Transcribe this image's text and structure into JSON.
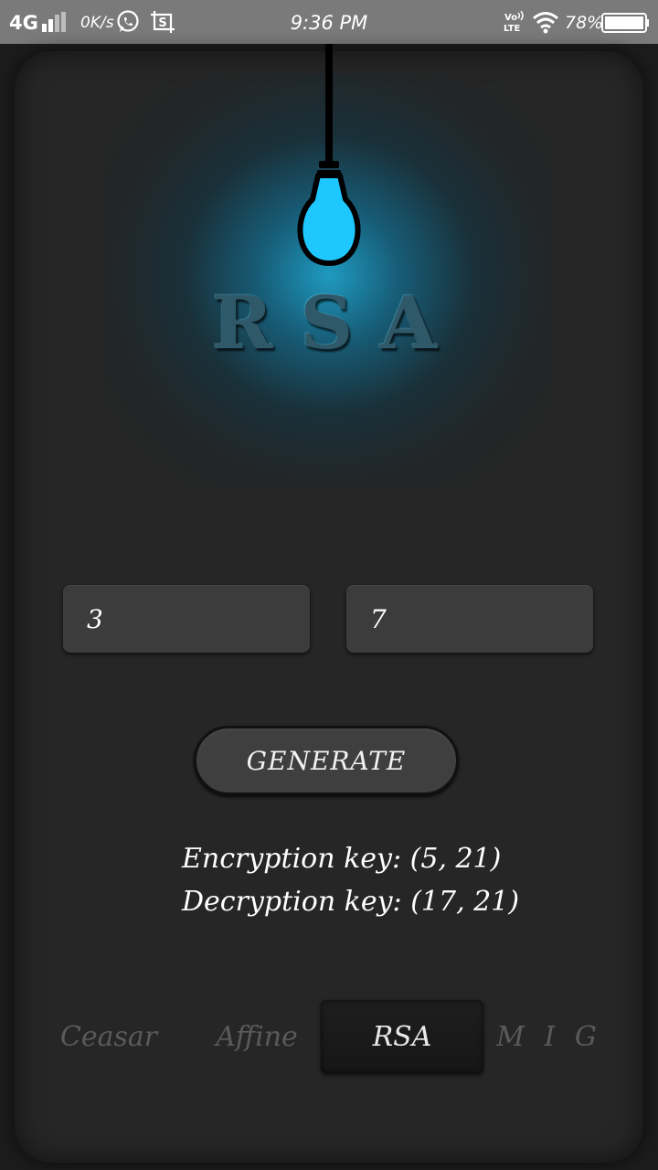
{
  "status_bar": {
    "network": "4G",
    "speed": "0K/s",
    "time": "9:36 PM",
    "volte": "VoLTE",
    "battery_pct": "78%",
    "icons": [
      "signal-icon",
      "whatsapp-icon",
      "screenshot-icon",
      "volte-icon",
      "wifi-icon",
      "battery-icon"
    ]
  },
  "header": {
    "logo_title": "RSA",
    "bulb_color": "#1ec8ff"
  },
  "inputs": {
    "p_value": "3",
    "q_value": "7"
  },
  "actions": {
    "generate_label": "GENERATE"
  },
  "results": {
    "encryption": "Encryption key: (5, 21)",
    "decryption": "Decryption key: (17, 21)"
  },
  "tabs": [
    {
      "label": "Ceasar",
      "active": false
    },
    {
      "label": "Affine",
      "active": false
    },
    {
      "label": "RSA",
      "active": true
    },
    {
      "label": "M I G",
      "active": false
    }
  ],
  "colors": {
    "background": "#262626",
    "accent_glow": "#1ea0c8",
    "tab_inactive": "#5a5a5a",
    "text": "#ffffff"
  }
}
